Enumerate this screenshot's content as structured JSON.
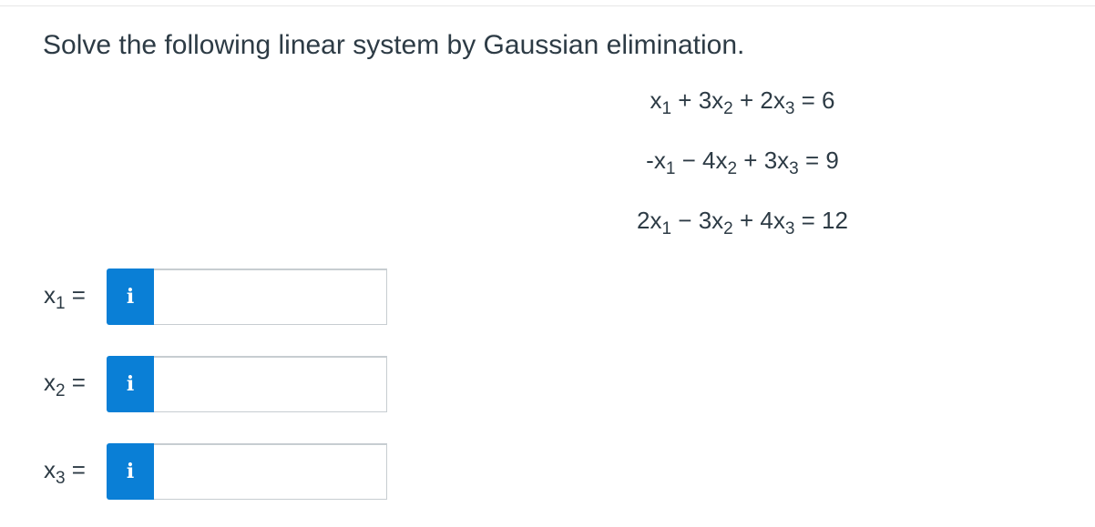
{
  "question": {
    "prompt": "Solve the following linear system by Gaussian elimination."
  },
  "equations": [
    [
      {
        "t": "x"
      },
      {
        "s": "1"
      },
      {
        "t": " + 3x"
      },
      {
        "s": "2"
      },
      {
        "t": " + 2x"
      },
      {
        "s": "3"
      },
      {
        "t": " = 6"
      }
    ],
    [
      {
        "t": "-x"
      },
      {
        "s": "1"
      },
      {
        "t": " − 4x"
      },
      {
        "s": "2"
      },
      {
        "t": " + 3x"
      },
      {
        "s": "3"
      },
      {
        "t": " = 9"
      }
    ],
    [
      {
        "t": "2x"
      },
      {
        "s": "1"
      },
      {
        "t": " − 3x"
      },
      {
        "s": "2"
      },
      {
        "t": " + 4x"
      },
      {
        "s": "3"
      },
      {
        "t": " = 12"
      }
    ]
  ],
  "answers": [
    {
      "var": "x",
      "sub": "1",
      "eq": " =",
      "info_label": "i",
      "value": "",
      "placeholder": ""
    },
    {
      "var": "x",
      "sub": "2",
      "eq": " =",
      "info_label": "i",
      "value": "",
      "placeholder": ""
    },
    {
      "var": "x",
      "sub": "3",
      "eq": " =",
      "info_label": "i",
      "value": "",
      "placeholder": ""
    }
  ],
  "colors": {
    "text": "#2d3b45",
    "info_button": "#0a7fd6",
    "input_border": "#c7cdd1"
  }
}
